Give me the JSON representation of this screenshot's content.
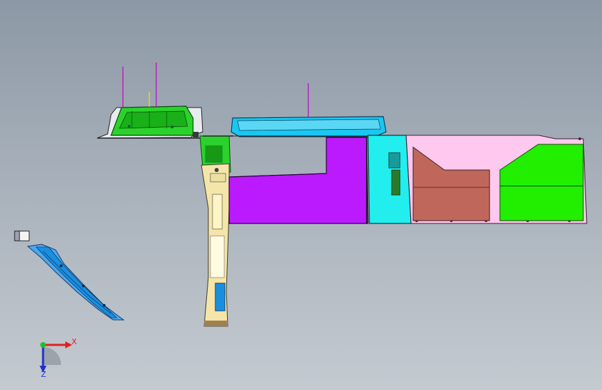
{
  "viewport": {
    "background_top": "#8c98a5",
    "background_bottom": "#c4cad0"
  },
  "parts": [
    {
      "name": "glovebox-panel",
      "color": "#22dd22"
    },
    {
      "name": "center-console-lid",
      "color": "#19c7f0"
    },
    {
      "name": "lower-dash-panel",
      "color": "#bb1aff"
    },
    {
      "name": "console-side-panel",
      "color": "#22eeee"
    },
    {
      "name": "floor-mat-brown",
      "color": "#c0675c"
    },
    {
      "name": "floor-mat-green",
      "color": "#22ee00"
    },
    {
      "name": "floor-carrier-pink",
      "color": "#ffc8ee"
    },
    {
      "name": "a-pillar-trim",
      "color": "#f5e5a8"
    },
    {
      "name": "b-pillar-trim",
      "color": "#1a8fe0"
    }
  ],
  "triad": {
    "x_label": "X",
    "z_label": "Z",
    "x_color": "#e02020",
    "y_color": "#20c020",
    "z_color": "#2030d0"
  }
}
